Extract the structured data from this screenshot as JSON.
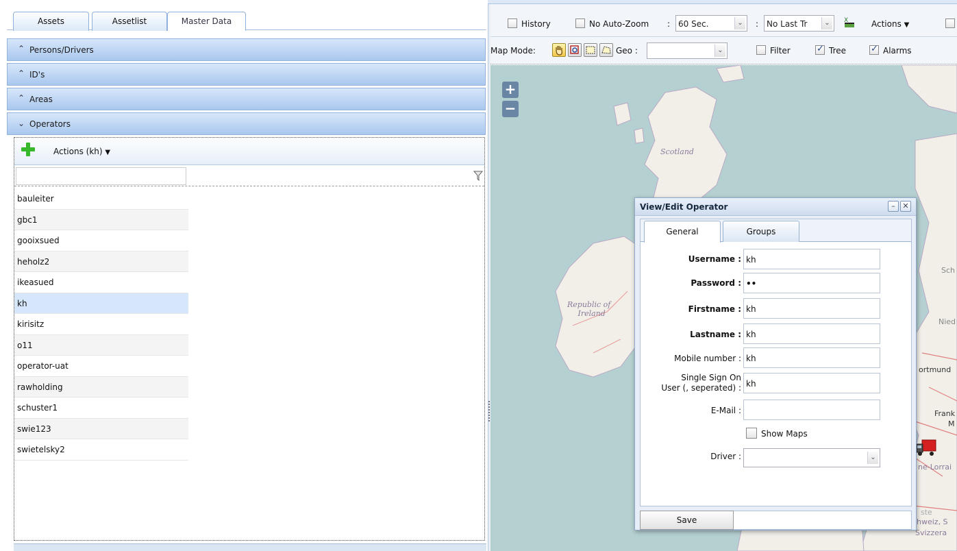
{
  "tabs": [
    {
      "label": "Assets"
    },
    {
      "label": "Assetlist"
    },
    {
      "label": "Master Data"
    }
  ],
  "accordion": [
    {
      "label": "Persons/Drivers",
      "state": "collapsed"
    },
    {
      "label": "ID's",
      "state": "collapsed"
    },
    {
      "label": "Areas",
      "state": "collapsed"
    },
    {
      "label": "Operators",
      "state": "expanded"
    }
  ],
  "operators": {
    "actions_label": "Actions (kh)",
    "filter_value": "",
    "items": [
      {
        "name": "bauleiter"
      },
      {
        "name": "gbc1"
      },
      {
        "name": "gooixsued"
      },
      {
        "name": "heholz2"
      },
      {
        "name": "ikeasued"
      },
      {
        "name": "kh"
      },
      {
        "name": "kirisitz"
      },
      {
        "name": "o11"
      },
      {
        "name": "operator-uat"
      },
      {
        "name": "rawholding"
      },
      {
        "name": "schuster1"
      },
      {
        "name": "swie123"
      },
      {
        "name": "swietelsky2"
      }
    ],
    "selected": "kh"
  },
  "map_toolbar": {
    "history_label": "History",
    "no_auto_zoom_label": "No Auto-Zoom",
    "colon": ":",
    "refresh_value": "60 Sec.",
    "last_track_value": "No Last Tr",
    "actions_label": "Actions",
    "map_mode_label": "Map Mode:",
    "geo_label": "Geo :",
    "geo_value": "",
    "filter_label": "Filter",
    "tree_label": "Tree",
    "alarms_label": "Alarms",
    "history_checked": false,
    "no_auto_zoom_checked": false,
    "filter_checked": false,
    "tree_checked": true,
    "alarms_checked": true
  },
  "map": {
    "zoom_in": "+",
    "zoom_out": "−",
    "labels": {
      "scotland": "Scotland",
      "ireland_1": "Republic of",
      "ireland_2": "Ireland",
      "dortmund": "ortmund",
      "nied": "Nied",
      "sch": "Sch",
      "frank": "Frank",
      "m": "M",
      "lorraine": "ne-Lorrai",
      "schweiz": "hweiz, S",
      "svizzera": "Svizzera",
      "ste": "ste"
    },
    "sea_color": "#b5d0d0",
    "land_color": "#f2efe9"
  },
  "dialog": {
    "title": "View/Edit Operator",
    "tabs": [
      {
        "label": "General"
      },
      {
        "label": "Groups"
      }
    ],
    "fields": {
      "username_label": "Username :",
      "username_value": "kh",
      "password_label": "Password :",
      "password_value": "••",
      "firstname_label": "Firstname :",
      "firstname_value": "kh",
      "lastname_label": "Lastname :",
      "lastname_value": "kh",
      "mobile_label": "Mobile number :",
      "mobile_value": "kh",
      "sso_label_1": "Single Sign On",
      "sso_label_2": "User (, seperated) :",
      "sso_value": "kh",
      "email_label": "E-Mail :",
      "email_value": "",
      "show_maps_label": "Show Maps",
      "show_maps_checked": false,
      "driver_label": "Driver :",
      "driver_value": ""
    },
    "save_label": "Save"
  }
}
